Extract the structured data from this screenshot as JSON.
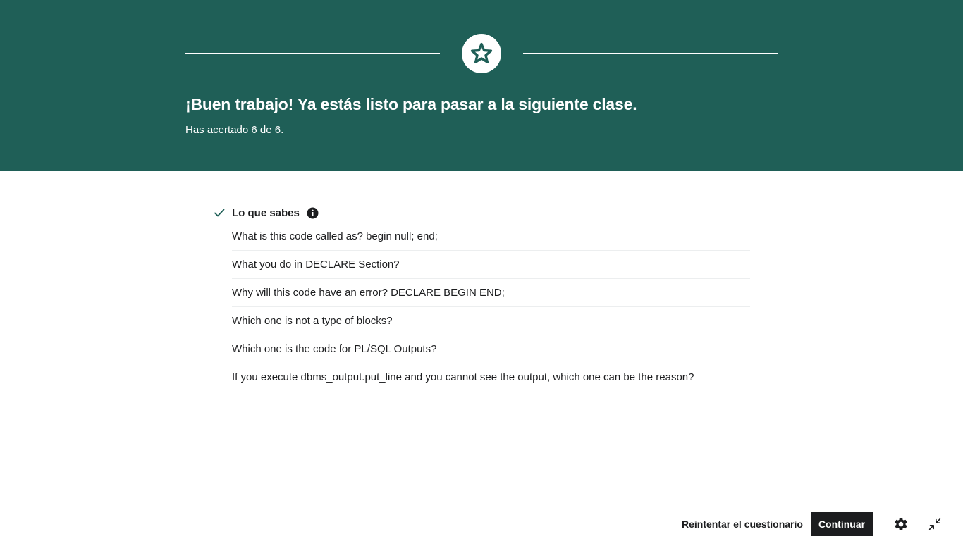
{
  "banner": {
    "headline": "¡Buen trabajo! Ya estás listo para pasar a la siguiente clase.",
    "score": "Has acertado 6 de 6.",
    "badge_icon": "star-icon",
    "color": "#1f5f57"
  },
  "section": {
    "title": "Lo que sabes",
    "status_icon": "check-icon",
    "info_icon": "info-icon",
    "questions": [
      "What is this code called as? begin null; end;",
      "What you do in DECLARE Section?",
      "Why will this code have an error? DECLARE BEGIN END;",
      "Which one is not a type of blocks?",
      "Which one is the code for PL/SQL Outputs?",
      "If you execute dbms_output.put_line and you cannot see the output, which one can be the reason?"
    ]
  },
  "footer": {
    "retry_label": "Reintentar el cuestionario",
    "continue_label": "Continuar",
    "settings_icon": "gear-icon",
    "exit_fullscreen_icon": "exit-fullscreen-icon"
  }
}
